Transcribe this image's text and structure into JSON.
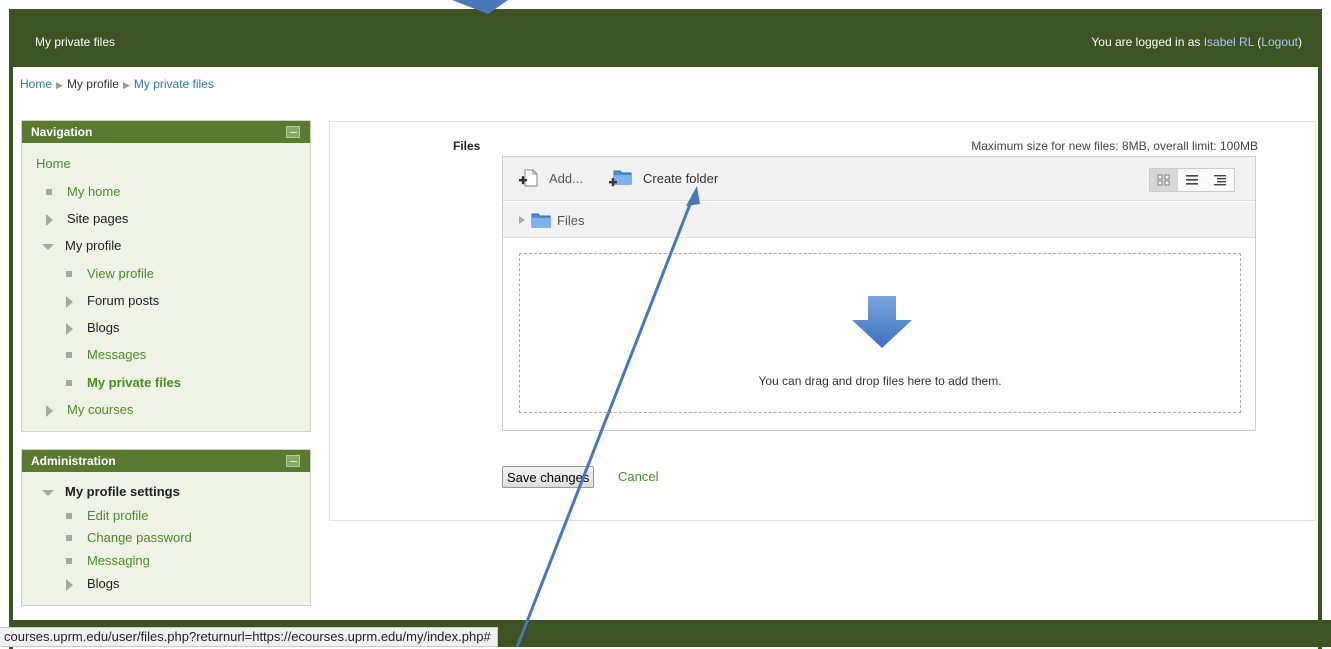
{
  "header": {
    "title": "My private files",
    "login_prefix": "You are logged in as ",
    "user_name": "Isabel RL",
    "logout_open": " (",
    "logout_label": "Logout",
    "logout_close": ")"
  },
  "breadcrumb": {
    "items": [
      "Home",
      "My profile",
      "My private files"
    ],
    "separator": "▶"
  },
  "navigation": {
    "title": "Navigation",
    "items": [
      "Home",
      "My home",
      "Site pages",
      "My profile",
      "View profile",
      "Forum posts",
      "Blogs",
      "Messages",
      "My private files",
      "My courses"
    ]
  },
  "administration": {
    "title": "Administration",
    "items": [
      "My profile settings",
      "Edit profile",
      "Change password",
      "Messaging",
      "Blogs"
    ]
  },
  "files": {
    "label": "Files",
    "max_size": "Maximum size for new files: 8MB, overall limit: 100MB",
    "add_label": "Add...",
    "create_folder_label": "Create folder",
    "path_label": "Files",
    "drop_text": "You can drag and drop files here to add them.",
    "view_modes": [
      "icons-view-icon",
      "list-view-icon",
      "tree-view-icon"
    ],
    "active_view": "icons-view-icon"
  },
  "actions": {
    "save_label": "Save changes",
    "cancel_label": "Cancel"
  },
  "status_bar": {
    "url": "courses.uprm.edu/user/files.php?returnurl=https://ecourses.uprm.edu/my/index.php#"
  },
  "colors": {
    "brand_green": "#3d5323",
    "block_header": "#5a7a32",
    "link_green": "#4c8a2a",
    "annotation_blue": "#4a77b7"
  }
}
